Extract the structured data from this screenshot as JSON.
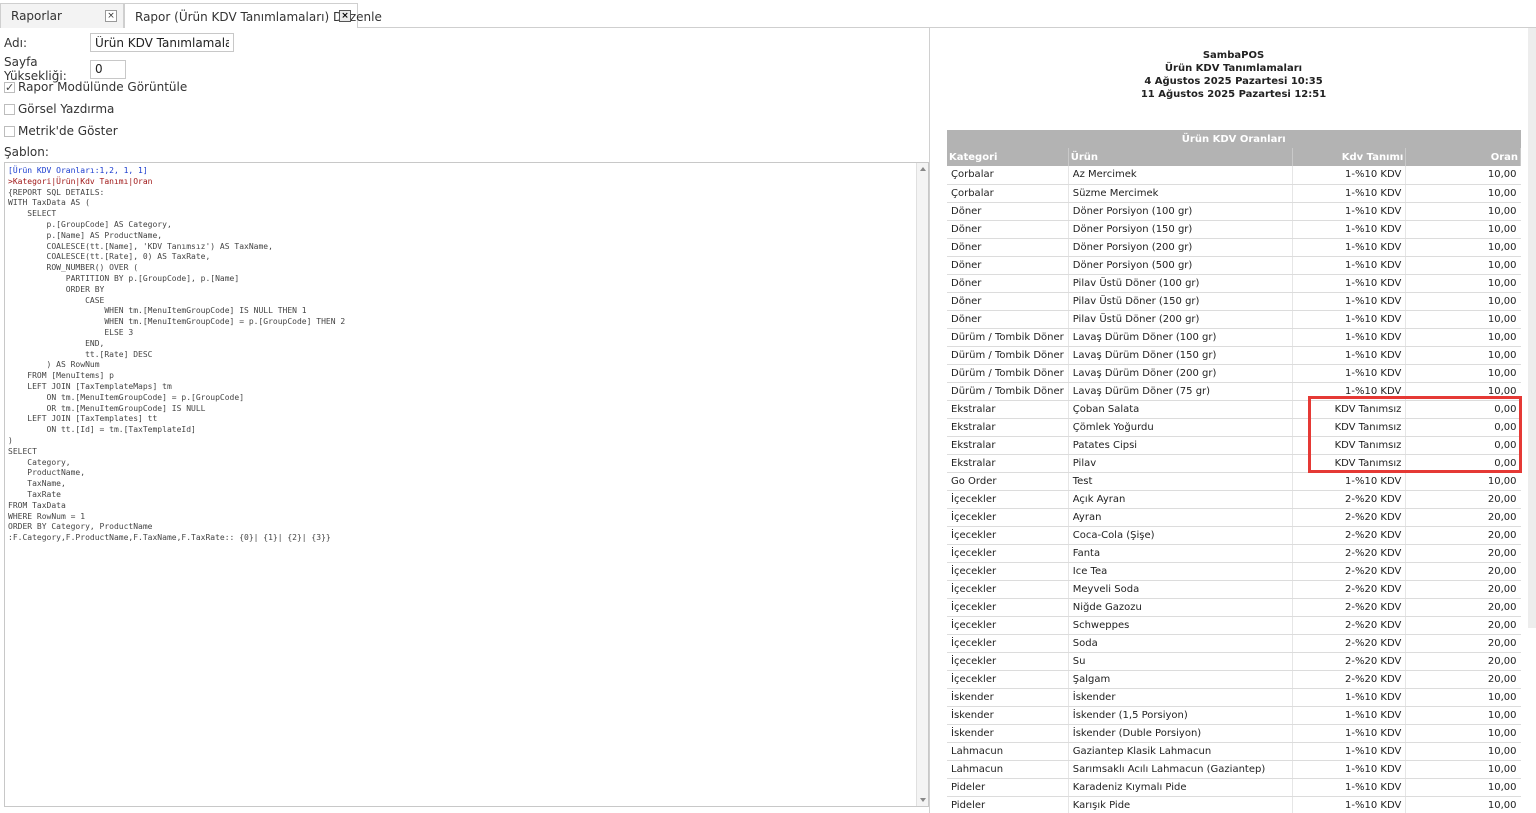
{
  "tabs": [
    {
      "label": "Raporlar",
      "close": "×"
    },
    {
      "label": "Rapor (Ürün KDV Tanımlamaları) Düzenle",
      "close": "×"
    }
  ],
  "form": {
    "name_label": "Adı:",
    "name_value": "Ürün KDV Tanımlamaları",
    "page_height_label": "Sayfa Yüksekliği:",
    "page_height_value": "0",
    "show_in_reports_label": "Rapor Modülünde Görüntüle",
    "show_in_reports_checked": true,
    "visual_print_label": "Görsel Yazdırma",
    "visual_print_checked": false,
    "show_in_metric_label": "Metrik'de Göster",
    "show_in_metric_checked": false,
    "template_label": "Şablon:",
    "check_mark": "✓"
  },
  "template_lines": [
    "[Ürün KDV Oranları:1,2, 1, 1]",
    ">Kategori|Ürün|Kdv Tanımı|Oran",
    "{REPORT SQL DETAILS:",
    "WITH TaxData AS (",
    "    SELECT",
    "        p.[GroupCode] AS Category,",
    "        p.[Name] AS ProductName,",
    "        COALESCE(tt.[Name], 'KDV Tanımsız') AS TaxName,",
    "        COALESCE(tt.[Rate], 0) AS TaxRate,",
    "        ROW_NUMBER() OVER (",
    "            PARTITION BY p.[GroupCode], p.[Name]",
    "            ORDER BY",
    "                CASE",
    "                    WHEN tm.[MenuItemGroupCode] IS NULL THEN 1",
    "                    WHEN tm.[MenuItemGroupCode] = p.[GroupCode] THEN 2",
    "                    ELSE 3",
    "                END,",
    "                tt.[Rate] DESC",
    "        ) AS RowNum",
    "    FROM [MenuItems] p",
    "    LEFT JOIN [TaxTemplateMaps] tm",
    "        ON tm.[MenuItemGroupCode] = p.[GroupCode]",
    "        OR tm.[MenuItemGroupCode] IS NULL",
    "    LEFT JOIN [TaxTemplates] tt",
    "        ON tt.[Id] = tm.[TaxTemplateId]",
    ")",
    "SELECT",
    "    Category,",
    "    ProductName,",
    "    TaxName,",
    "    TaxRate",
    "FROM TaxData",
    "WHERE RowNum = 1",
    "ORDER BY Category, ProductName",
    ":F.Category,F.ProductName,F.TaxName,F.TaxRate:: {0}| {1}| {2}| {3}}"
  ],
  "report": {
    "company": "SambaPOS",
    "title": "Ürün KDV Tanımlamaları",
    "date_from": "4 Ağustos 2025 Pazartesi 10:35",
    "date_to": "11 Ağustos 2025 Pazartesi 12:51",
    "table_caption": "Ürün KDV Oranları",
    "columns": [
      "Kategori",
      "Ürün",
      "Kdv Tanımı",
      "Oran"
    ],
    "rows": [
      [
        "Çorbalar",
        "Az Mercimek",
        "1-%10 KDV",
        "10,00"
      ],
      [
        "Çorbalar",
        "Süzme Mercimek",
        "1-%10 KDV",
        "10,00"
      ],
      [
        "Döner",
        "Döner Porsiyon (100 gr)",
        "1-%10 KDV",
        "10,00"
      ],
      [
        "Döner",
        "Döner Porsiyon (150 gr)",
        "1-%10 KDV",
        "10,00"
      ],
      [
        "Döner",
        "Döner Porsiyon (200 gr)",
        "1-%10 KDV",
        "10,00"
      ],
      [
        "Döner",
        "Döner Porsiyon (500 gr)",
        "1-%10 KDV",
        "10,00"
      ],
      [
        "Döner",
        "Pilav Üstü Döner (100 gr)",
        "1-%10 KDV",
        "10,00"
      ],
      [
        "Döner",
        "Pilav Üstü Döner (150 gr)",
        "1-%10 KDV",
        "10,00"
      ],
      [
        "Döner",
        "Pilav Üstü Döner (200 gr)",
        "1-%10 KDV",
        "10,00"
      ],
      [
        "Dürüm / Tombik Döner",
        "Lavaş Dürüm Döner (100 gr)",
        "1-%10 KDV",
        "10,00"
      ],
      [
        "Dürüm / Tombik Döner",
        "Lavaş Dürüm Döner (150 gr)",
        "1-%10 KDV",
        "10,00"
      ],
      [
        "Dürüm / Tombik Döner",
        "Lavaş Dürüm Döner (200 gr)",
        "1-%10 KDV",
        "10,00"
      ],
      [
        "Dürüm / Tombik Döner",
        "Lavaş Dürüm Döner (75 gr)",
        "1-%10 KDV",
        "10,00"
      ],
      [
        "Ekstralar",
        "Çoban Salata",
        "KDV Tanımsız",
        "0,00"
      ],
      [
        "Ekstralar",
        "Çömlek Yoğurdu",
        "KDV Tanımsız",
        "0,00"
      ],
      [
        "Ekstralar",
        "Patates Cipsi",
        "KDV Tanımsız",
        "0,00"
      ],
      [
        "Ekstralar",
        "Pilav",
        "KDV Tanımsız",
        "0,00"
      ],
      [
        "Go Order",
        "Test",
        "1-%10 KDV",
        "10,00"
      ],
      [
        "İçecekler",
        "Açık Ayran",
        "2-%20 KDV",
        "20,00"
      ],
      [
        "İçecekler",
        "Ayran",
        "2-%20 KDV",
        "20,00"
      ],
      [
        "İçecekler",
        "Coca-Cola (Şişe)",
        "2-%20 KDV",
        "20,00"
      ],
      [
        "İçecekler",
        "Fanta",
        "2-%20 KDV",
        "20,00"
      ],
      [
        "İçecekler",
        "Ice Tea",
        "2-%20 KDV",
        "20,00"
      ],
      [
        "İçecekler",
        "Meyveli Soda",
        "2-%20 KDV",
        "20,00"
      ],
      [
        "İçecekler",
        "Niğde Gazozu",
        "2-%20 KDV",
        "20,00"
      ],
      [
        "İçecekler",
        "Schweppes",
        "2-%20 KDV",
        "20,00"
      ],
      [
        "İçecekler",
        "Soda",
        "2-%20 KDV",
        "20,00"
      ],
      [
        "İçecekler",
        "Su",
        "2-%20 KDV",
        "20,00"
      ],
      [
        "İçecekler",
        "Şalgam",
        "2-%20 KDV",
        "20,00"
      ],
      [
        "İskender",
        "İskender",
        "1-%10 KDV",
        "10,00"
      ],
      [
        "İskender",
        "İskender (1,5 Porsiyon)",
        "1-%10 KDV",
        "10,00"
      ],
      [
        "İskender",
        "İskender (Duble Porsiyon)",
        "1-%10 KDV",
        "10,00"
      ],
      [
        "Lahmacun",
        "Gaziantep Klasik Lahmacun",
        "1-%10 KDV",
        "10,00"
      ],
      [
        "Lahmacun",
        "Sarımsaklı Acılı Lahmacun (Gaziantep)",
        "1-%10 KDV",
        "10,00"
      ],
      [
        "Pideler",
        "Karadeniz Kıymalı Pide",
        "1-%10 KDV",
        "10,00"
      ],
      [
        "Pideler",
        "Karışık Pide",
        "1-%10 KDV",
        "10,00"
      ]
    ]
  },
  "colors": {
    "header_bg": "#b3b3b3",
    "highlight": "#e53935",
    "code_blue": "#1a3ccf",
    "code_red": "#a01818"
  }
}
